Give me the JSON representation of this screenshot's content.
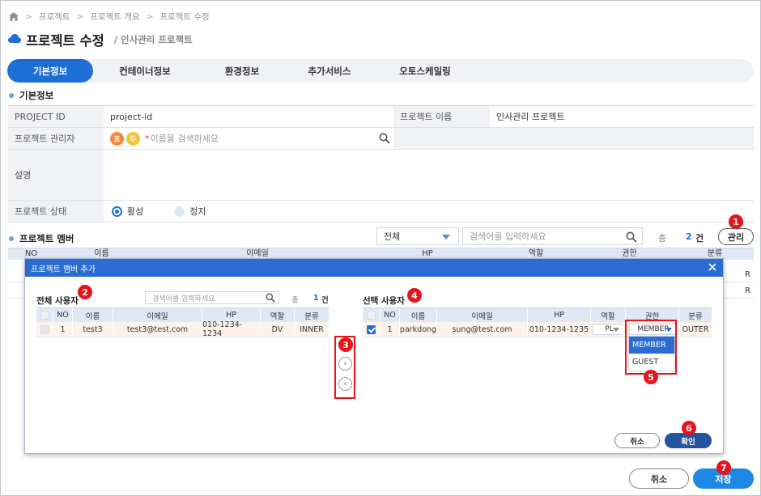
{
  "breadcrumb": {
    "items": [
      "프로젝트",
      "프로젝트 개요",
      "프로젝트 수정"
    ]
  },
  "page": {
    "title": "프로젝트 수정",
    "subtitle": "/ 인사관리 프로젝트"
  },
  "tabs": [
    {
      "label": "기본정보",
      "active": true
    },
    {
      "label": "컨테이너정보",
      "active": false
    },
    {
      "label": "환경정보",
      "active": false
    },
    {
      "label": "추가서비스",
      "active": false
    },
    {
      "label": "오토스케일링",
      "active": false
    }
  ],
  "basic": {
    "section_title": "기본정보",
    "project_id_label": "PROJECT ID",
    "project_id_value": "project-id",
    "project_name_label": "프로젝트 이름",
    "project_name_value": "인사관리 프로젝트",
    "manager_label": "프로젝트 관리자",
    "manager_avatars": [
      "포",
      "두"
    ],
    "manager_required": "*",
    "manager_placeholder": "이름을 검색하세요",
    "desc_label": "설명",
    "status_label": "프로젝트 상태",
    "status_active": "활성",
    "status_stopped": "정지"
  },
  "members": {
    "section_title": "프로젝트 멤버",
    "filter_value": "전체",
    "search_placeholder": "검색어를 입력하세요",
    "total_label": "총",
    "total_count": "2",
    "total_unit": "건",
    "manage_label": "관리",
    "bg_columns": [
      "NO",
      "이름",
      "이메일",
      "HP",
      "역할",
      "권한",
      "분류"
    ],
    "bg_row_tails": [
      "R",
      "R"
    ]
  },
  "modal": {
    "title": "프로젝트 멤버 추가",
    "all_users": {
      "title": "전체 사용자",
      "search_placeholder": "검색어를 입력하세요",
      "total_label": "총",
      "total_count": "1",
      "total_unit": "건",
      "columns": [
        "NO",
        "이름",
        "이메일",
        "HP",
        "역할",
        "분류"
      ],
      "rows": [
        {
          "no": "1",
          "name": "test3",
          "email": "test3@test.com",
          "hp": "010-1234-1234",
          "role": "DV",
          "type": "INNER"
        }
      ]
    },
    "selected_users": {
      "title": "선택 사용자",
      "columns": [
        "NO",
        "이름",
        "이메일",
        "HP",
        "역할",
        "권한",
        "분류"
      ],
      "rows": [
        {
          "no": "1",
          "name": "parkdong",
          "email": "sung@test.com",
          "hp": "010-1234-1235",
          "role": "PL",
          "permission": "MEMBER",
          "type": "OUTER"
        }
      ]
    },
    "permission_options": [
      "MEMBER",
      "GUEST"
    ],
    "cancel_label": "취소",
    "confirm_label": "확인"
  },
  "footer": {
    "cancel_label": "취소",
    "save_label": "저장"
  },
  "badges": [
    "1",
    "2",
    "3",
    "4",
    "5",
    "6",
    "7"
  ],
  "colors": {
    "primary": "#1d6fd6",
    "header_blue": "#2a6cd1",
    "callout_red": "#e8141b",
    "confirm": "#24539f"
  }
}
